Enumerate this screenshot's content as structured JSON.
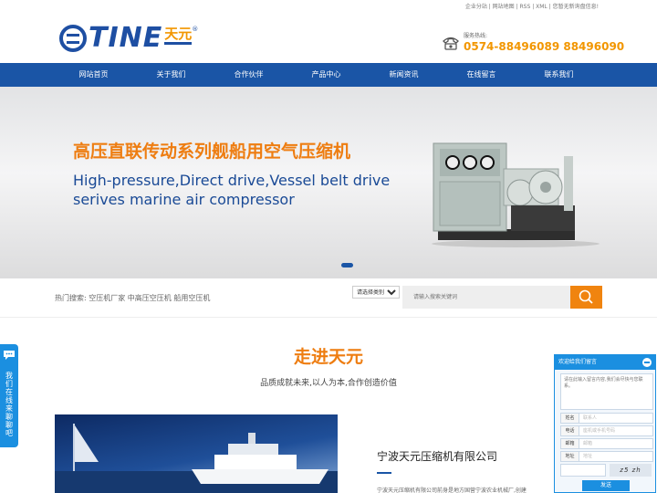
{
  "header": {
    "top_links": "企业分站 | 网站地图 | RSS | XML | 您暂无新询盘信息!",
    "logo_text": "TINE",
    "logo_cn": "天元",
    "logo_reg": "®",
    "hotline_label": "服务热线:",
    "hotline_number": "0574-88496089 88496090"
  },
  "nav": {
    "items": [
      "网站首页",
      "关于我们",
      "合作伙伴",
      "产品中心",
      "新闻资讯",
      "在线留言",
      "联系我们"
    ]
  },
  "banner": {
    "title": "高压直联传动系列舰船用空气压缩机",
    "subtitle_line1": "High-pressure,Direct drive,Vessel belt drive",
    "subtitle_line2": "serives marine air compressor"
  },
  "search": {
    "hot_label": "热门搜索: 空压机厂家  中高压空压机  船用空压机",
    "select_value": "请选择类别",
    "placeholder": "请输入搜索关键词"
  },
  "about": {
    "title": "走进天元",
    "subtitle": "品质成就未来,以人为本,合作创造价值",
    "company_name": "宁波天元压缩机有限公司",
    "desc": "宁波天元压缩机有限公司前身是地方国营宁波农业机械厂,创建"
  },
  "side_tab": {
    "label": "我们在线 来聊聊吧"
  },
  "message_widget": {
    "title": "欢迎给我们留言",
    "message_placeholder": "请在此输入留言内容,我们会尽快与您联系。",
    "fields": [
      {
        "label": "姓名",
        "placeholder": "联系人"
      },
      {
        "label": "电话",
        "placeholder": "座机或手机号码"
      },
      {
        "label": "邮箱",
        "placeholder": "邮箱"
      },
      {
        "label": "地址",
        "placeholder": "地址"
      }
    ],
    "captcha": "z5 zh",
    "send_label": "发送"
  }
}
